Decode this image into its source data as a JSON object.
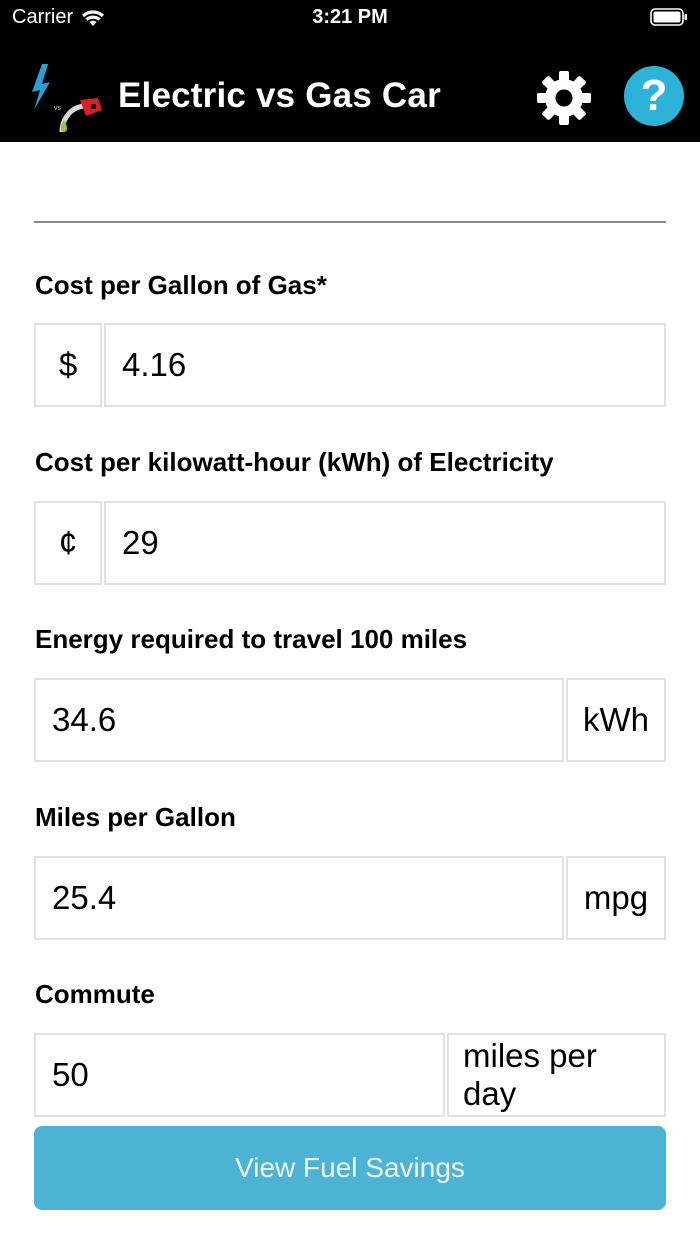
{
  "status": {
    "carrier": "Carrier",
    "time": "3:21 PM"
  },
  "nav": {
    "title": "Electric vs Gas Car",
    "help_glyph": "?"
  },
  "colors": {
    "nav_bg": "#000000",
    "help_bg": "#2db2d8",
    "button_bg": "#4db3d4",
    "border": "#e1e1e1"
  },
  "fields": {
    "gas_cost": {
      "label": "Cost per Gallon of Gas*",
      "prefix": "$",
      "value": "4.16"
    },
    "electric_cost": {
      "label": "Cost per kilowatt-hour (kWh) of Electricity",
      "prefix": "¢",
      "value": "29"
    },
    "energy": {
      "label": "Energy required to travel 100 miles",
      "value": "34.6",
      "suffix": "kWh"
    },
    "mpg": {
      "label": "Miles per Gallon",
      "value": "25.4",
      "suffix": "mpg"
    },
    "commute": {
      "label": "Commute",
      "value": "50",
      "suffix": "miles per day"
    }
  },
  "actions": {
    "view_savings": "View Fuel Savings"
  }
}
